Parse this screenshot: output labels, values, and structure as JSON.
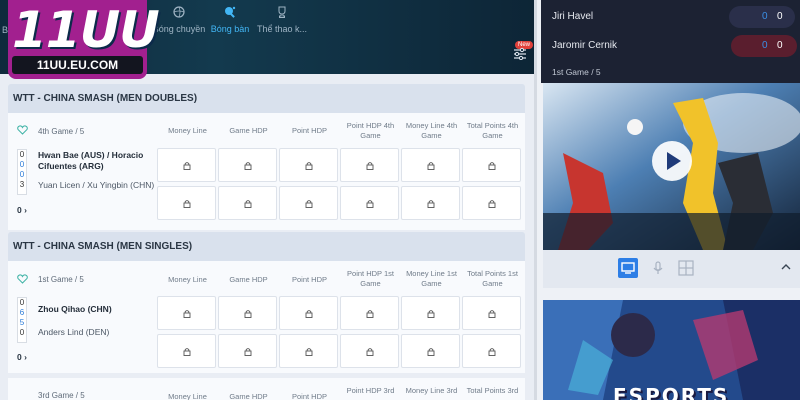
{
  "brand": {
    "logo_text": "11UU",
    "logo_url": "11UU.EU.COM",
    "accent": "#a2208f"
  },
  "sport_tabs": [
    {
      "label": "B",
      "icon": "sport-icon"
    },
    {
      "label": "Bóng chuyền",
      "icon": "volleyball-icon"
    },
    {
      "label": "Bóng bàn",
      "icon": "table-tennis-icon",
      "active": true
    },
    {
      "label": "Thể thao k...",
      "icon": "trophy-icon"
    }
  ],
  "filter": {
    "badge": "New",
    "icon": "filter-icon"
  },
  "leagues": [
    {
      "title": "WTT - CHINA SMASH (MEN DOUBLES)",
      "game_label": "4th Game / 5",
      "columns": [
        "Money Line",
        "Game HDP",
        "Point HDP",
        "Point HDP 4th Game",
        "Money Line 4th Game",
        "Total Points 4th Game"
      ],
      "team1": "Hwan Bae (AUS) / Horacio Cifuentes (ARG)",
      "team2": "Yuan Licen / Xu Yingbin (CHN)",
      "scores": [
        "0",
        "0",
        "0",
        "3"
      ],
      "more": "0"
    },
    {
      "title": "WTT - CHINA SMASH (MEN SINGLES)",
      "game_label": "1st Game / 5",
      "columns": [
        "Money Line",
        "Game HDP",
        "Point HDP",
        "Point HDP 1st Game",
        "Money Line 1st Game",
        "Total Points 1st Game"
      ],
      "team1": "Zhou Qihao (CHN)",
      "team2": "Anders Lind (DEN)",
      "scores": [
        "0",
        "6",
        "5",
        "0"
      ],
      "more": "0"
    },
    {
      "game_label": "3rd Game / 5",
      "columns": [
        "Money Line",
        "Game HDP",
        "Point HDP",
        "Point HDP 3rd",
        "Money Line 3rd",
        "Total Points 3rd"
      ]
    }
  ],
  "live": {
    "player1": "Jiri Havel",
    "p1_score_a": "0",
    "p1_score_b": "0",
    "player2": "Jaromir Cernik",
    "p2_score_a": "0",
    "p2_score_b": "0",
    "status": "1st Game / 5"
  },
  "media": {
    "icons": [
      "tv-icon",
      "microphone-icon",
      "grid-icon"
    ],
    "collapse_icon": "chevron-up-icon"
  },
  "banner": {
    "title": "ESPORTS"
  }
}
